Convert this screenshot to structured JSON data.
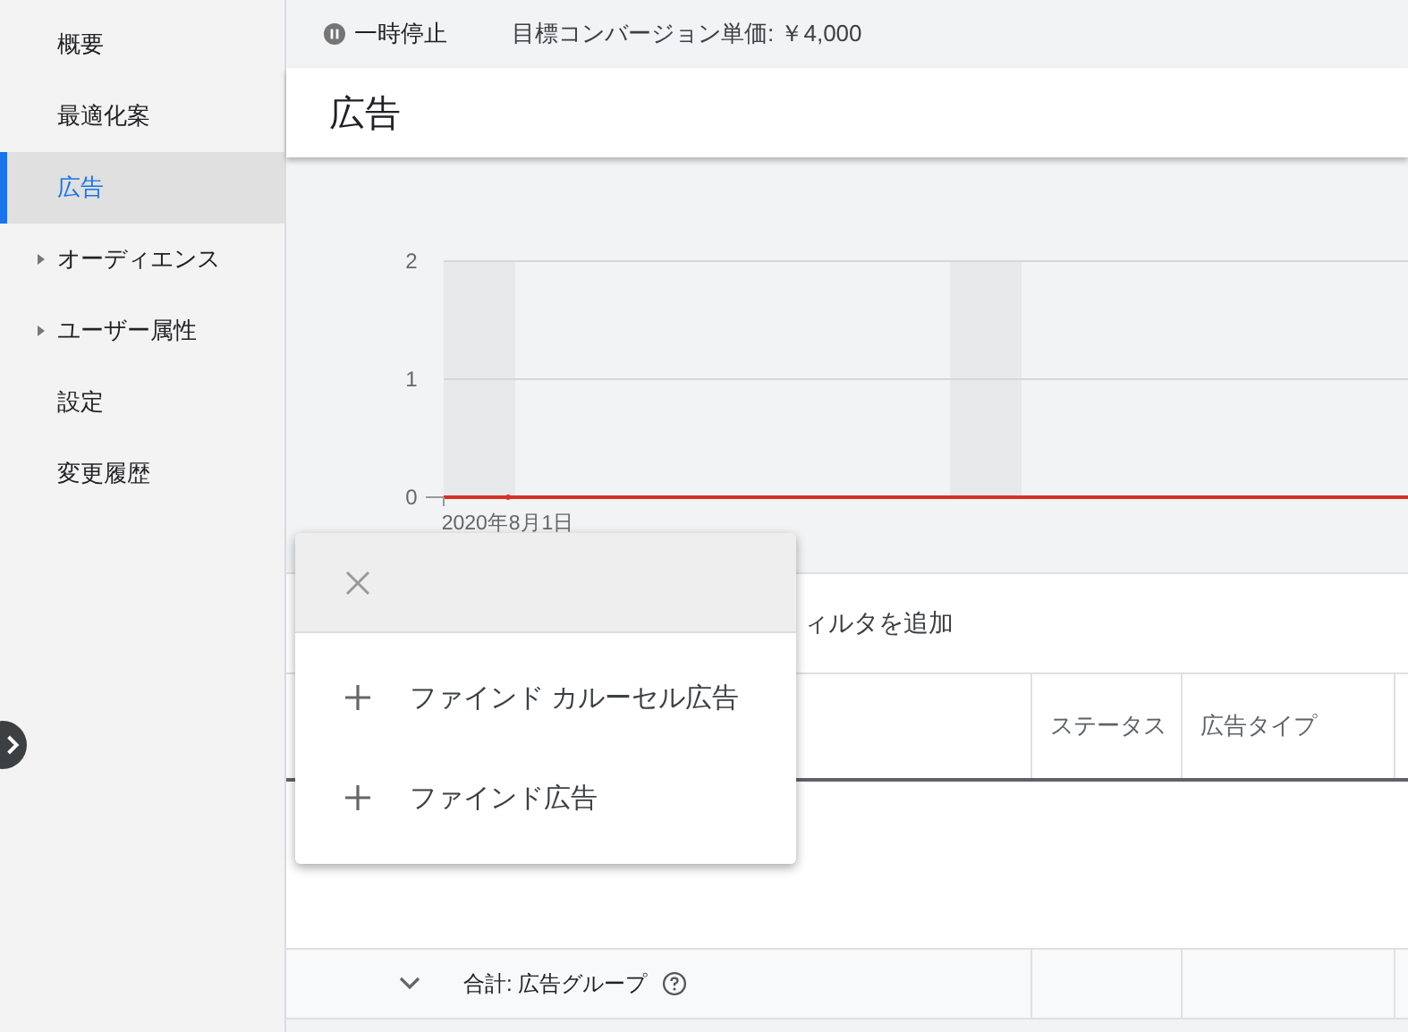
{
  "sidebar": {
    "items": [
      {
        "label": "概要",
        "kind": "link",
        "selected": false
      },
      {
        "label": "最適化案",
        "kind": "link",
        "selected": false
      },
      {
        "label": "広告",
        "kind": "link",
        "selected": true
      },
      {
        "label": "オーディエンス",
        "kind": "group",
        "selected": false
      },
      {
        "label": "ユーザー属性",
        "kind": "group",
        "selected": false
      },
      {
        "label": "設定",
        "kind": "link",
        "selected": false
      },
      {
        "label": "変更履歴",
        "kind": "link",
        "selected": false
      }
    ]
  },
  "status_bar": {
    "status": "一時停止",
    "target": "目標コンバージョン単価: ￥4,000"
  },
  "page_title": "広告",
  "chart": {
    "chart_data": {
      "type": "line",
      "x": [
        "2020年8月1日"
      ],
      "ylim": [
        0,
        2
      ],
      "yticks": [
        0,
        1,
        2
      ],
      "series": [
        {
          "color": "#d93025",
          "marker": "circle",
          "values": [
            0
          ]
        }
      ]
    }
  },
  "filter": {
    "label": "ィルタを追加"
  },
  "table": {
    "columns": [
      {
        "label": "ステータス"
      },
      {
        "label": "広告タイプ"
      }
    ],
    "total_row": {
      "label": "合計: 広告グループ"
    }
  },
  "menu": {
    "items": [
      {
        "label": "ファインド カルーセル広告"
      },
      {
        "label": "ファインド広告"
      }
    ]
  }
}
